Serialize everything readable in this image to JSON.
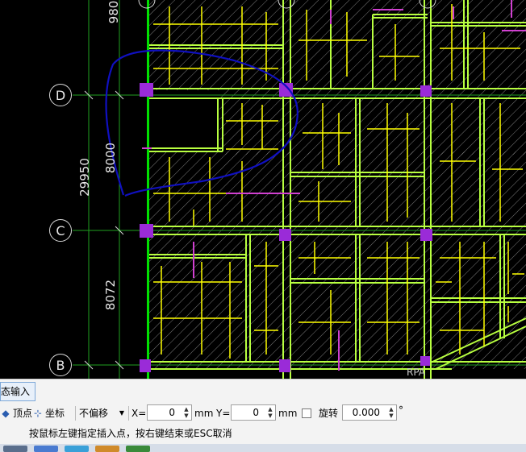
{
  "axes": {
    "rows": [
      {
        "label": "D"
      },
      {
        "label": "C"
      },
      {
        "label": "B"
      }
    ]
  },
  "dimensions": {
    "top_partial": "980",
    "d_to_c": "8000",
    "total": "29950",
    "c_to_b": "8072"
  },
  "plan_marker": "RPA",
  "toolbar": {
    "tab_label": "态输入",
    "vertex_label": "顶点",
    "coord_label": "坐标",
    "offset_select": "不偏移",
    "x_label": "X=",
    "x_value": "0",
    "x_unit": "mm",
    "y_label": "Y=",
    "y_value": "0",
    "y_unit": "mm",
    "rotate_label": "旋转",
    "rotate_value": "0.000",
    "degree_symbol": "°"
  },
  "status": {
    "prompt": "按鼠标左键指定插入点，按右键结束或ESC取消"
  },
  "colors": {
    "background": "#000000",
    "grid_line": "#00c000",
    "beam": "#b8ff40",
    "rebar": "#ffff00",
    "column": "#9a2bd8",
    "neg_rebar": "#d040d0",
    "annotation_stroke": "#1010c0",
    "hatch": "#a0a0a0"
  },
  "icons": [
    "vertex-icon",
    "coord-icon",
    "dropdown-arrow-icon",
    "spinner-icon",
    "checkbox-icon"
  ]
}
